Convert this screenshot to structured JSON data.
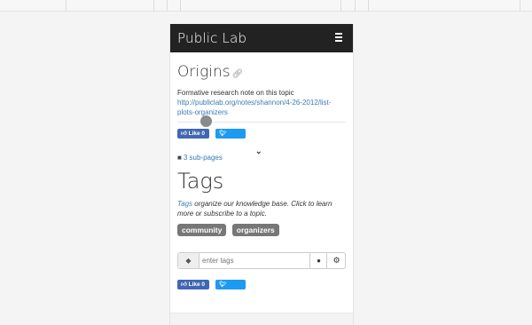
{
  "navbar": {
    "brand": "Public Lab",
    "menu_icon": "hamburger-icon"
  },
  "note": {
    "title": "Origins",
    "link_icon": "link-icon",
    "summary": "Formative research note on this topic",
    "source_link": "http://publiclab.org/notes/shannon/4-26-2012/list-plots-organizers"
  },
  "share": {
    "like_label": "Like 0",
    "tweet_label": "Tweet"
  },
  "subpages": {
    "label": "3 sub-pages",
    "icon": "book-icon"
  },
  "tags": {
    "title": "Tags",
    "desc_link": "Tags",
    "desc_rest": " organize our knowledge base. Click to learn more or subscribe to a topic.",
    "items": [
      "community",
      "organizers"
    ],
    "input_placeholder": "enter tags",
    "prefix_icon": "tags-icon",
    "location_icon": "map-marker-icon",
    "settings_icon": "gear-icon"
  },
  "colors": {
    "navbar": "#222222",
    "link": "#3a7bb5",
    "facebook": "#4267b2",
    "twitter": "#1d9bf0",
    "badge": "#777777"
  }
}
